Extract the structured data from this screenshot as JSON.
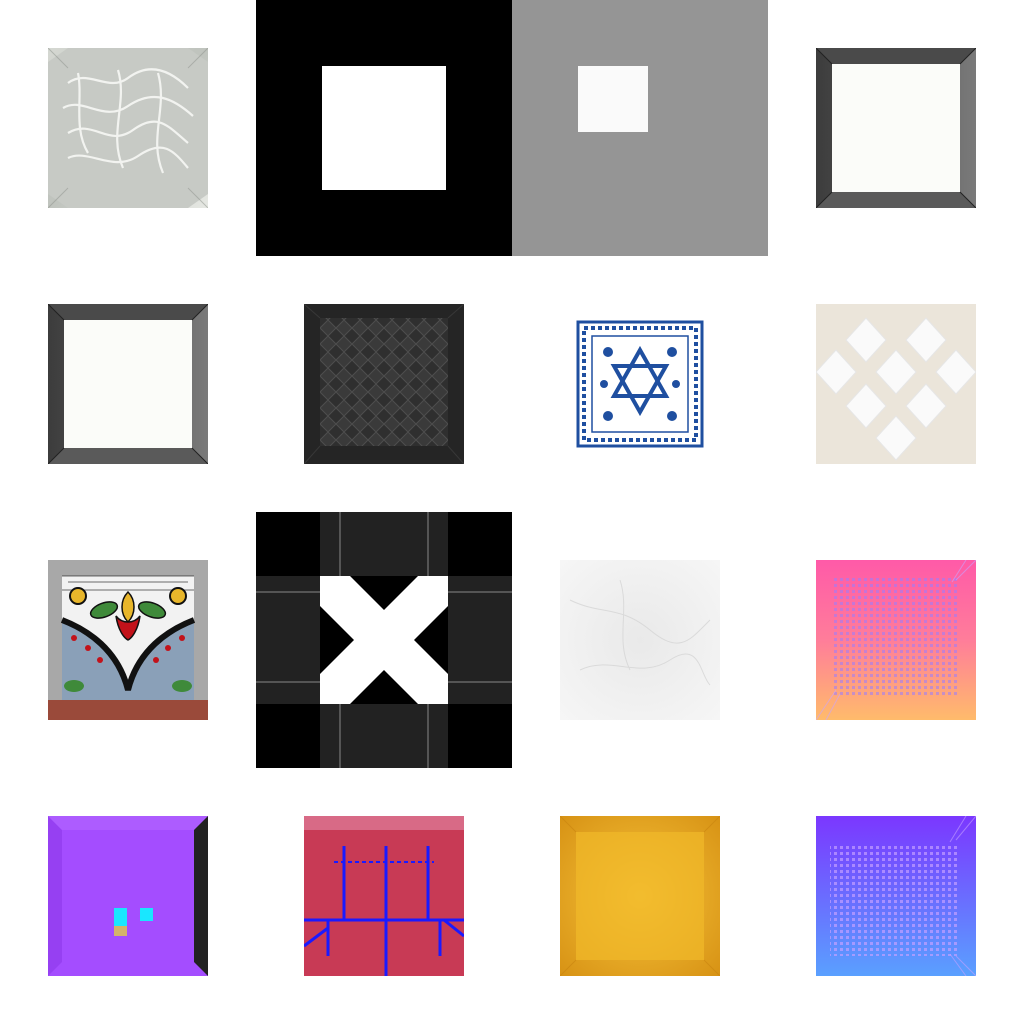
{
  "tiles": [
    {
      "name": "water-caustics-tile",
      "kind": "image",
      "colors": [
        "#c9ccc7",
        "#f2f4f0",
        "#8d918a"
      ]
    },
    {
      "name": "black-frame-white-square-tile",
      "kind": "graphic",
      "colors": [
        "#000000",
        "#ffffff"
      ]
    },
    {
      "name": "gray-frame-white-square-tile",
      "kind": "graphic",
      "colors": [
        "#959595",
        "#fafafa"
      ]
    },
    {
      "name": "beveled-white-square-tile",
      "kind": "graphic",
      "colors": [
        "#555555",
        "#fbfcf9"
      ]
    },
    {
      "name": "beveled-white-square-tile-2",
      "kind": "graphic",
      "colors": [
        "#555555",
        "#fbfcf9"
      ]
    },
    {
      "name": "dark-diamond-quilt-tile",
      "kind": "image",
      "colors": [
        "#2a2a2a",
        "#4a4a4a"
      ]
    },
    {
      "name": "blue-star-of-david-tile",
      "kind": "image",
      "colors": [
        "#1f4fa0",
        "#ffffff"
      ]
    },
    {
      "name": "marble-checker-tile",
      "kind": "image",
      "colors": [
        "#eae3d8",
        "#ffffff"
      ]
    },
    {
      "name": "talavera-floral-tile",
      "kind": "image",
      "colors": [
        "#a54a3a",
        "#c2121a",
        "#e8b62b",
        "#3f8a3a"
      ]
    },
    {
      "name": "black-x-grid-tile",
      "kind": "graphic",
      "colors": [
        "#000000",
        "#222222",
        "#ffffff",
        "#555555"
      ]
    },
    {
      "name": "white-marble-tile",
      "kind": "image",
      "colors": [
        "#f1f1f1",
        "#e2e2e2"
      ]
    },
    {
      "name": "pink-orange-dither-tile",
      "kind": "graphic",
      "colors": [
        "#ff5aa8",
        "#ffb86b",
        "#9a7dff"
      ]
    },
    {
      "name": "purple-room-tile",
      "kind": "graphic",
      "colors": [
        "#a44dff",
        "#222222",
        "#19e7ff",
        "#d4b36a"
      ]
    },
    {
      "name": "red-blue-grid-tile",
      "kind": "graphic",
      "colors": [
        "#c83a55",
        "#1a1aff"
      ]
    },
    {
      "name": "gold-texture-tile",
      "kind": "image",
      "colors": [
        "#f1b92a",
        "#d79413"
      ]
    },
    {
      "name": "violet-blue-dither-tile",
      "kind": "graphic",
      "colors": [
        "#7b37ff",
        "#5aa0ff",
        "#c7a1ff"
      ]
    }
  ]
}
